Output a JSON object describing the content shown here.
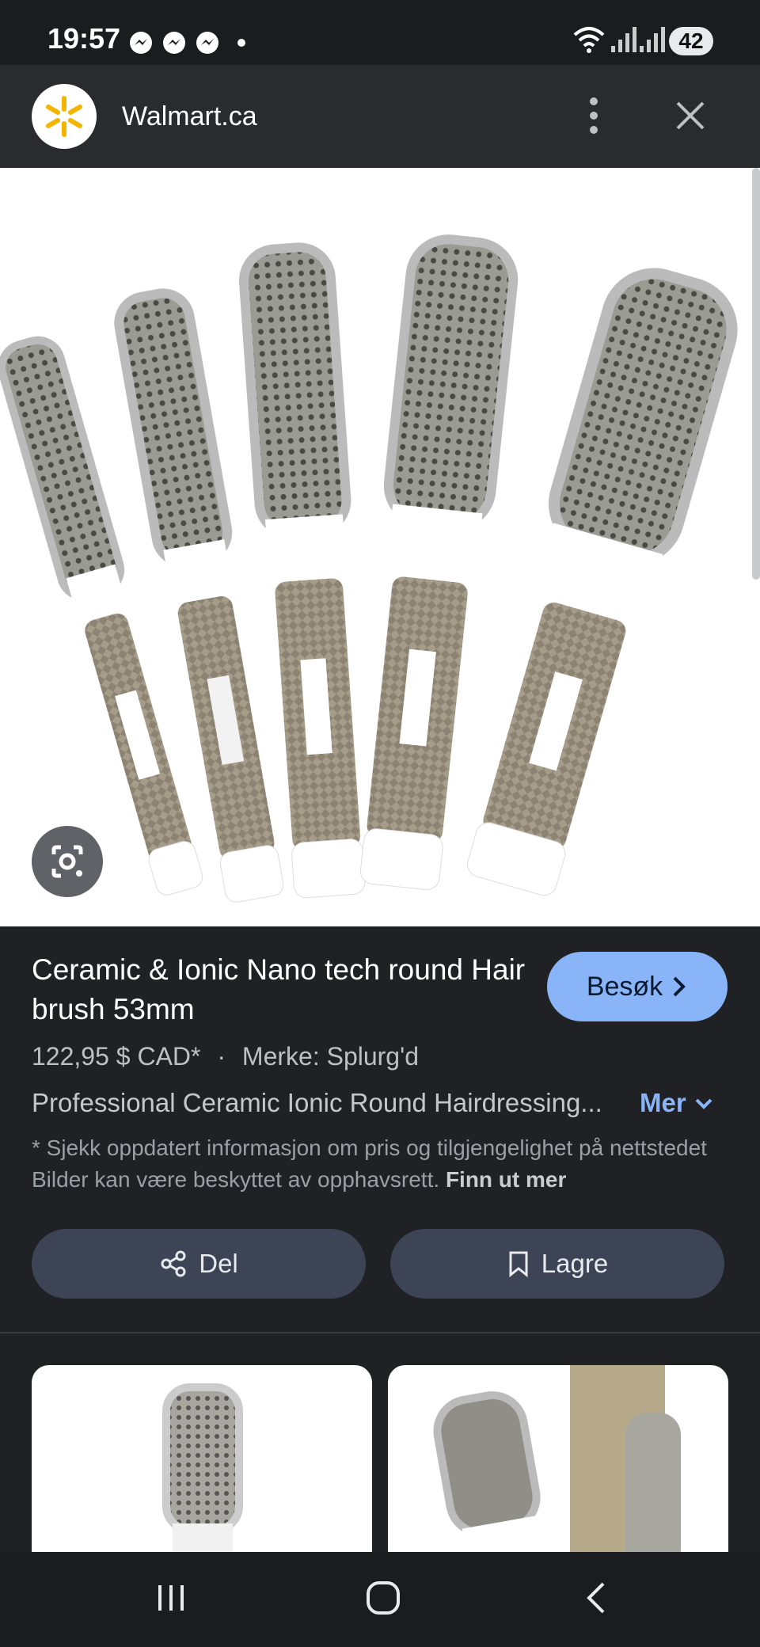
{
  "status_bar": {
    "time": "19:57",
    "battery": "42",
    "icons": [
      "messenger-icon",
      "messenger-icon",
      "messenger-icon",
      "dot",
      "wifi-icon",
      "signal-icon",
      "signal-icon"
    ]
  },
  "top_bar": {
    "site_name": "Walmart.ca",
    "icons": [
      "walmart-logo",
      "more-vert-icon",
      "close-icon"
    ]
  },
  "product": {
    "title": "Ceramic & Ionic Nano tech round Hair brush 53mm",
    "visit_label": "Besøk",
    "price": "122,95 $ CAD*",
    "separator": "·",
    "brand": "Merke: Splurg'd",
    "description": "Professional Ceramic Ionic Round Hairdressing...",
    "more_label": "Mer",
    "disclaimer": "* Sjekk oppdatert informasjon om pris og tilgjengelighet på nettstedet Bilder kan være beskyttet av opphavsrett.",
    "learn_more": "Finn ut mer"
  },
  "actions": {
    "share_label": "Del",
    "save_label": "Lagre"
  },
  "colors": {
    "background": "#202124",
    "accent": "#8ab4f8",
    "button_bg": "#3c4456"
  }
}
